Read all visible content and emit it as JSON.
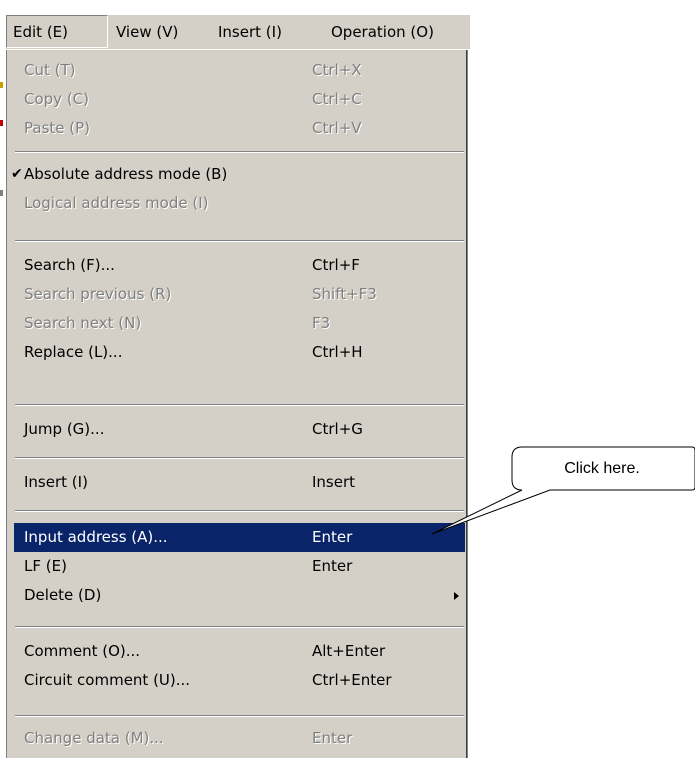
{
  "menubar": {
    "items": [
      {
        "label": "Edit (E)"
      },
      {
        "label": "View (V)"
      },
      {
        "label": "Insert (I)"
      },
      {
        "label": "Operation (O)"
      }
    ]
  },
  "edit_menu": {
    "items": [
      {
        "label": "Cut (T)",
        "shortcut": "Ctrl+X"
      },
      {
        "label": "Copy (C)",
        "shortcut": "Ctrl+C"
      },
      {
        "label": "Paste (P)",
        "shortcut": "Ctrl+V"
      },
      {
        "label": "Absolute address mode (B)",
        "shortcut": "",
        "checked": true
      },
      {
        "label": "Logical address mode (I)",
        "shortcut": ""
      },
      {
        "label": "Search (F)...",
        "shortcut": "Ctrl+F"
      },
      {
        "label": "Search previous (R)",
        "shortcut": "Shift+F3"
      },
      {
        "label": "Search next (N)",
        "shortcut": "F3"
      },
      {
        "label": "Replace (L)...",
        "shortcut": "Ctrl+H"
      },
      {
        "label": "Jump (G)...",
        "shortcut": "Ctrl+G"
      },
      {
        "label": "Insert (I)",
        "shortcut": "Insert"
      },
      {
        "label": "Input address (A)...",
        "shortcut": "Enter",
        "highlighted": true
      },
      {
        "label": "LF (E)",
        "shortcut": "Enter"
      },
      {
        "label": "Delete (D)",
        "shortcut": "",
        "submenu": true
      },
      {
        "label": "Comment (O)...",
        "shortcut": "Alt+Enter"
      },
      {
        "label": "Circuit comment (U)...",
        "shortcut": "Ctrl+Enter"
      },
      {
        "label": "Change data (M)...",
        "shortcut": "Enter"
      }
    ]
  },
  "callout": {
    "text": "Click here."
  },
  "colors": {
    "menu_background": "#d4d0c8",
    "highlight": "#0a246a",
    "disabled_text": "#808080"
  }
}
